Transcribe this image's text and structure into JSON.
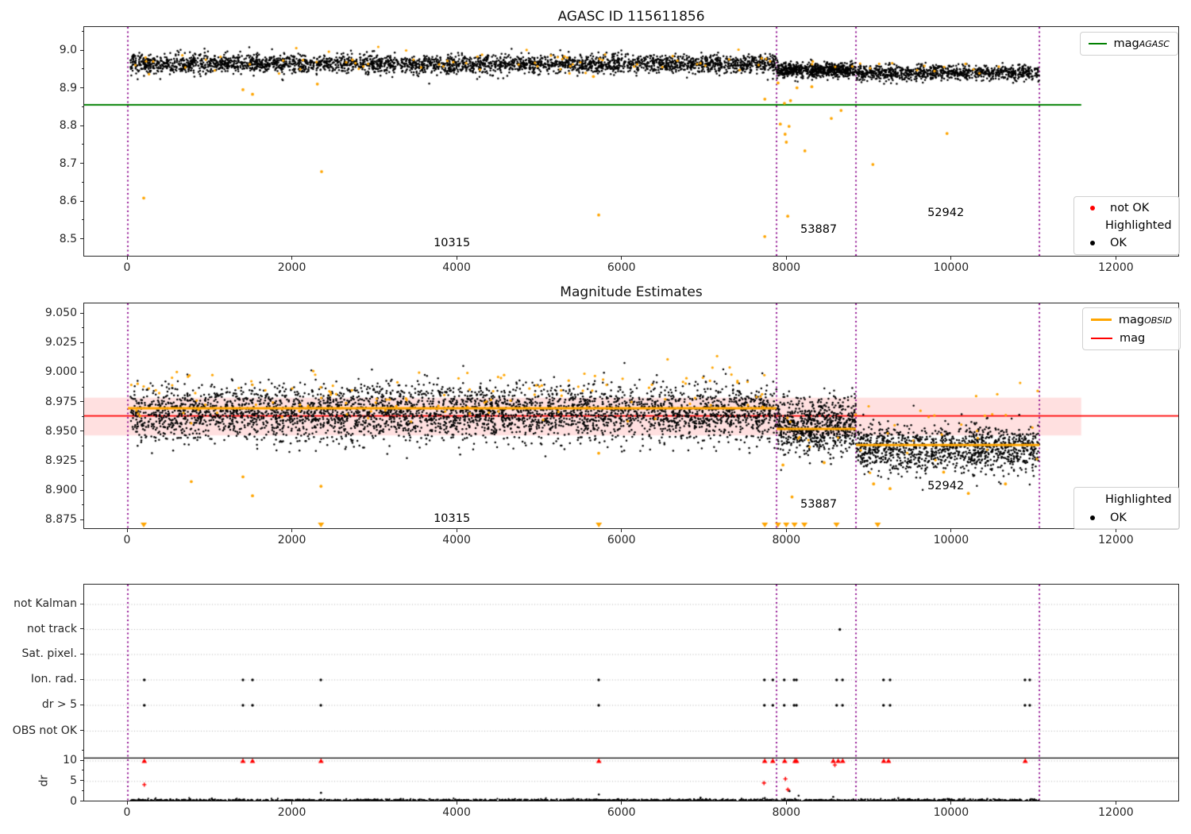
{
  "titles": {
    "top": "AGASC ID 115611856",
    "middle": "Magnitude Estimates"
  },
  "colors": {
    "green": "#008000",
    "orange": "#ffa500",
    "red": "#ff0000",
    "black": "#000000",
    "purple": "#8B008B",
    "band": "rgba(255,0,0,0.12)",
    "grid": "#b4b4b4",
    "axis": "#262626"
  },
  "legends": {
    "mag_agasc": {
      "main": "mag",
      "sub": "AGASC"
    },
    "top_markers": [
      {
        "label": "not OK",
        "color": "#ff0000"
      },
      {
        "label": "Highlighted",
        "color": "#ffa500"
      },
      {
        "label": "OK",
        "color": "#000000"
      }
    ],
    "mag_lines": [
      {
        "main": "mag",
        "sub": "OBSID",
        "color": "#ffa500"
      },
      {
        "main": "mag",
        "sub": "",
        "color": "#ff0000"
      }
    ],
    "mid_markers": [
      {
        "label": "Highlighted",
        "color": "#ffa500"
      },
      {
        "label": "OK",
        "color": "#000000"
      }
    ]
  },
  "chart_data": [
    {
      "type": "scatter",
      "title": "AGASC ID 115611856",
      "xlim": [
        -530,
        12770
      ],
      "ylim": [
        8.455,
        9.059
      ],
      "xticks": {
        "values": [
          0,
          2000,
          4000,
          6000,
          8000,
          10000,
          12000
        ],
        "labels": [
          "0",
          "2000",
          "4000",
          "6000",
          "8000",
          "10000",
          "12000"
        ]
      },
      "yticks": {
        "values": [
          9.0,
          8.9,
          8.8,
          8.7,
          8.6,
          8.5
        ],
        "labels": [
          "9.0",
          "8.9",
          "8.8",
          "8.7",
          "8.6",
          "8.5"
        ],
        "minors": [
          9.05,
          8.95,
          8.85,
          8.75,
          8.65,
          8.55
        ]
      },
      "green_hline": {
        "y": 8.857,
        "x0": -530,
        "x1": 11570
      },
      "vlines": [
        0,
        7872,
        8836,
        11062
      ],
      "black_clusters": [
        {
          "x0": 30,
          "x1": 7870,
          "n": 3200,
          "mean": 8.965,
          "sd": 0.012
        },
        {
          "x0": 7875,
          "x1": 8835,
          "n": 650,
          "mean": 8.949,
          "sd": 0.01
        },
        {
          "x0": 8840,
          "x1": 11060,
          "n": 950,
          "mean": 8.942,
          "sd": 0.01
        }
      ],
      "orange_clusters": [
        {
          "x0": 30,
          "x1": 7870,
          "n": 70,
          "mean": 8.968,
          "sd": 0.016
        },
        {
          "x0": 7875,
          "x1": 11060,
          "n": 16,
          "mean": 8.955,
          "sd": 0.012
        }
      ],
      "orange_outliers": [
        [
          193,
          8.61
        ],
        [
          2351,
          8.68
        ],
        [
          5714,
          8.565
        ],
        [
          7729,
          8.508
        ],
        [
          8008,
          8.562
        ],
        [
          7918,
          8.806
        ],
        [
          8024,
          8.8
        ],
        [
          7976,
          8.779
        ],
        [
          7991,
          8.758
        ],
        [
          8216,
          8.735
        ],
        [
          8537,
          8.821
        ],
        [
          9041,
          8.699
        ],
        [
          9941,
          8.781
        ],
        [
          7968,
          8.861
        ],
        [
          8042,
          8.868
        ],
        [
          7730,
          8.872
        ],
        [
          8655,
          8.842
        ],
        [
          7890,
          8.915
        ],
        [
          8120,
          8.902
        ],
        [
          8300,
          8.905
        ],
        [
          1397,
          8.897
        ],
        [
          1513,
          8.885
        ],
        [
          2300,
          8.912
        ],
        [
          5650,
          8.932
        ]
      ],
      "annotations": [
        {
          "text": "10315",
          "x": 3720,
          "y": 8.5055
        },
        {
          "text": "53887",
          "x": 8171,
          "y": 8.5413
        },
        {
          "text": "52942",
          "x": 9713,
          "y": 8.5854
        }
      ]
    },
    {
      "type": "scatter",
      "title": "Magnitude Estimates",
      "xlim": [
        -530,
        12770
      ],
      "ylim": [
        8.8676,
        9.0594
      ],
      "xticks": {
        "values": [
          0,
          2000,
          4000,
          6000,
          8000,
          10000,
          12000
        ],
        "labels": [
          "0",
          "2000",
          "4000",
          "6000",
          "8000",
          "10000",
          "12000"
        ]
      },
      "yticks": {
        "values": [
          9.05,
          9.025,
          9.0,
          8.975,
          8.95,
          8.925,
          8.9,
          8.875
        ],
        "labels": [
          "9.050",
          "9.025",
          "9.000",
          "8.975",
          "8.950",
          "8.925",
          "8.900",
          "8.875"
        ],
        "minors": [
          9.0375,
          9.0125,
          8.9875,
          8.9625,
          8.9375,
          8.9125,
          8.8875
        ]
      },
      "mag_line": {
        "y": 8.9636
      },
      "band": {
        "y0": 8.947,
        "y1": 8.979,
        "x0": -530,
        "x1": 11570
      },
      "steps": [
        {
          "x0": 0,
          "x1": 7872,
          "y": 8.97
        },
        {
          "x0": 7872,
          "x1": 8836,
          "y": 8.9525
        },
        {
          "x0": 8836,
          "x1": 11062,
          "y": 8.939
        }
      ],
      "vlines": [
        0,
        7872,
        8836,
        11062
      ],
      "black_clusters": [
        {
          "x0": 30,
          "x1": 7870,
          "n": 3800,
          "mean": 8.966,
          "sd": 0.012
        },
        {
          "x0": 7875,
          "x1": 8835,
          "n": 700,
          "mean": 8.955,
          "sd": 0.012
        },
        {
          "x0": 8840,
          "x1": 11060,
          "n": 1150,
          "mean": 8.936,
          "sd": 0.0095
        }
      ],
      "orange_clusters": [
        {
          "x0": 30,
          "x1": 7870,
          "n": 85,
          "mean": 8.988,
          "sd": 0.01
        },
        {
          "x0": 30,
          "x1": 7870,
          "n": 45,
          "mean": 8.969,
          "sd": 0.005
        },
        {
          "x0": 7875,
          "x1": 8835,
          "n": 8,
          "mean": 8.951,
          "sd": 0.008
        },
        {
          "x0": 8840,
          "x1": 11060,
          "n": 25,
          "mean": 8.96,
          "sd": 0.018
        }
      ],
      "orange_outliers": [
        [
          1397,
          8.912
        ],
        [
          1513,
          8.896
        ],
        [
          2344,
          8.904
        ],
        [
          770,
          8.908
        ],
        [
          5714,
          8.932
        ],
        [
          8060,
          8.895
        ],
        [
          9050,
          8.906
        ],
        [
          9900,
          8.916
        ],
        [
          10650,
          8.906
        ],
        [
          7950,
          8.922
        ],
        [
          8450,
          8.924
        ],
        [
          9250,
          8.902
        ],
        [
          10200,
          8.898
        ]
      ],
      "clip_triangles": [
        193,
        2344,
        5716,
        7730,
        7890,
        7990,
        8090,
        8210,
        8600,
        9100
      ],
      "annotations": [
        {
          "text": "10315",
          "x": 3720,
          "y": 8.881
        },
        {
          "text": "53887",
          "x": 8171,
          "y": 8.8934
        },
        {
          "text": "52942",
          "x": 9713,
          "y": 8.9089
        }
      ]
    },
    {
      "type": "flags_dr",
      "xlim": [
        -530,
        12770
      ],
      "xticks": {
        "values": [
          0,
          2000,
          4000,
          6000,
          8000,
          10000,
          12000
        ],
        "labels": [
          "0",
          "2000",
          "4000",
          "6000",
          "8000",
          "10000",
          "12000"
        ]
      },
      "flag_rows": [
        "not Kalman",
        "not track",
        "Sat. pixel.",
        "Ion. rad.",
        "dr > 5",
        "OBS not OK"
      ],
      "dr_axis": {
        "label": "dr",
        "ticks": {
          "values": [
            10,
            5,
            0
          ],
          "labels": [
            "10",
            "5",
            "0"
          ],
          "minors": [
            12.5,
            7.5,
            2.5
          ]
        }
      },
      "hline_y_dr": 10.7,
      "vlines": [
        0,
        7872,
        8836,
        11062
      ],
      "flags": {
        "not track": [
          8640
        ],
        "Ion. rad.": [
          200,
          1397,
          1513,
          2342,
          5714,
          7725,
          7827,
          7966,
          8085,
          8114,
          8602,
          8673,
          9170,
          9250,
          10887,
          10945
        ],
        "dr > 5": [
          200,
          1397,
          1513,
          2342,
          5714,
          7725,
          7827,
          7966,
          8085,
          8114,
          8602,
          8673,
          9170,
          9250,
          10887,
          10945
        ]
      },
      "dr_red_clipped": [
        200,
        1397,
        1513,
        2344,
        5716,
        7729,
        7827,
        7971,
        8096,
        8115,
        8560,
        8620,
        8675,
        9173,
        9231,
        10890
      ],
      "dr_red_points": [
        [
          200,
          4.2
        ],
        [
          7720,
          4.6
        ],
        [
          7980,
          5.6
        ],
        [
          8010,
          3.0
        ],
        [
          8580,
          9.0
        ]
      ],
      "dr_black_spikes": [
        [
          2344,
          2.2
        ],
        [
          5716,
          1.8
        ],
        [
          8030,
          2.6
        ],
        [
          8140,
          1.5
        ],
        [
          8560,
          1.2
        ],
        [
          6950,
          1.0
        ],
        [
          9350,
          0.9
        ],
        [
          1020,
          0.8
        ],
        [
          10430,
          0.7
        ],
        [
          7730,
          0.9
        ],
        [
          11000,
          0.6
        ]
      ],
      "dr_black_base": {
        "x0": 30,
        "x1": 11060,
        "n": 2600,
        "mean": 0.3,
        "sd": 0.18
      }
    }
  ]
}
